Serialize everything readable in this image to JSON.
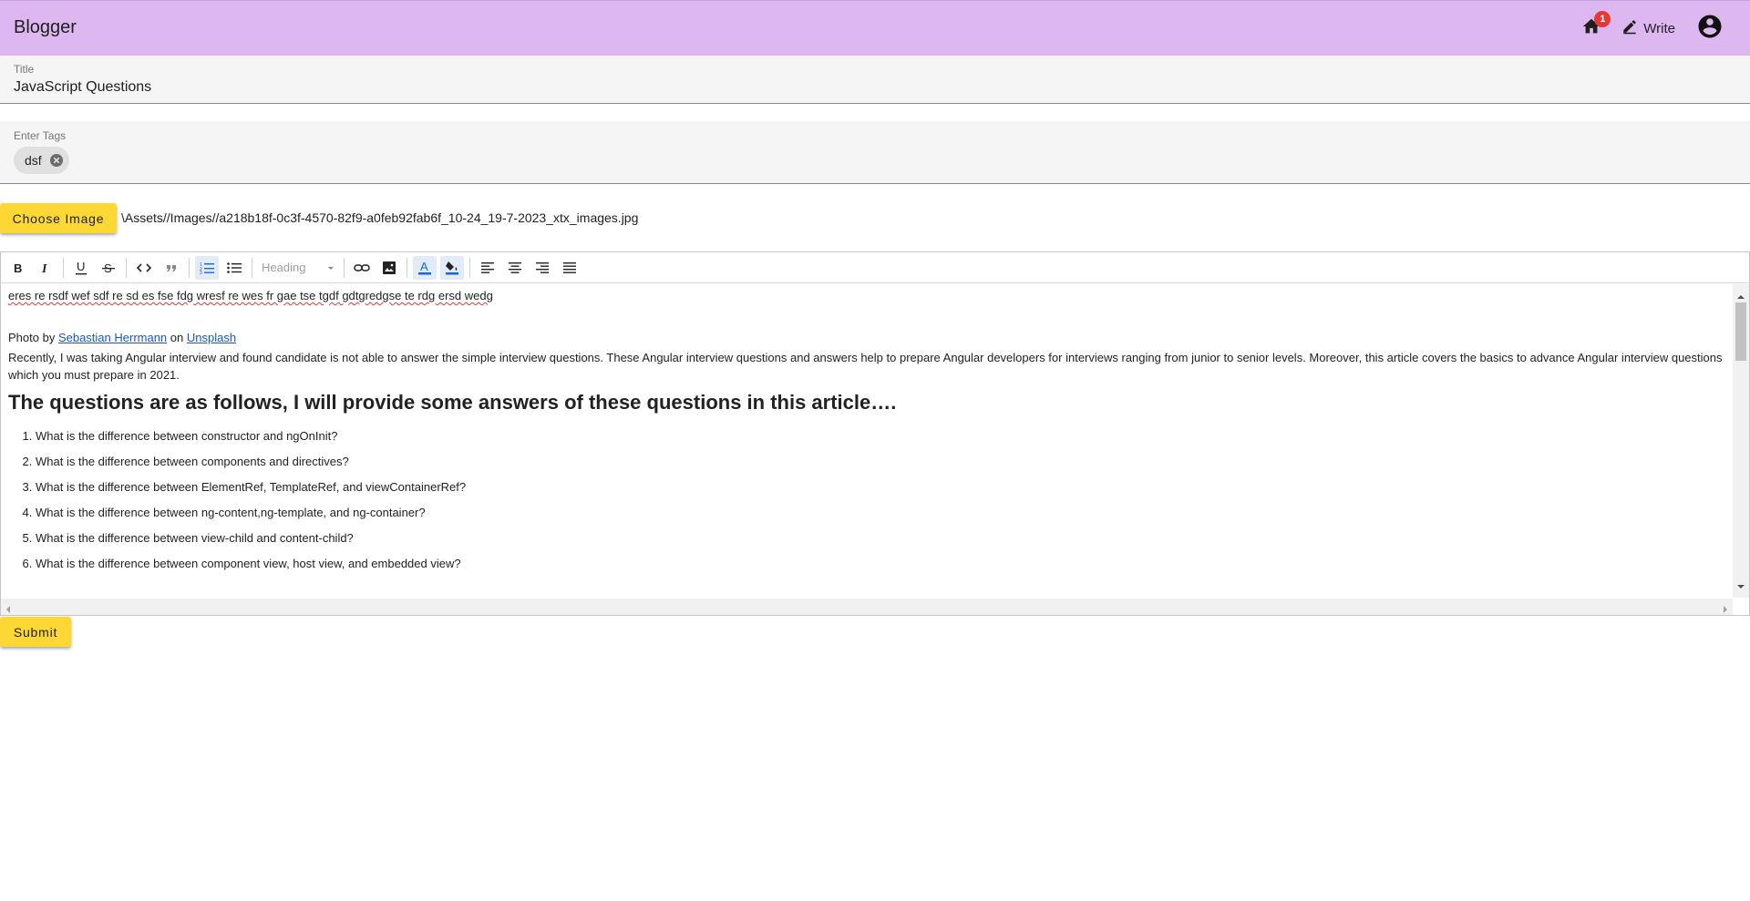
{
  "app": {
    "brand": "Blogger"
  },
  "header": {
    "notification_count": "1",
    "write_label": "Write"
  },
  "form": {
    "title_label": "Title",
    "title_value": "JavaScript Questions",
    "tags_label": "Enter Tags",
    "tags": [
      "dsf"
    ],
    "choose_image_label": "Choose Image",
    "image_path": "\\Assets//Images//a218b18f-0c3f-4570-82f9-a0feb92fab6f_10-24_19-7-2023_xtx_images.jpg",
    "submit_label": "Submit"
  },
  "toolbar": {
    "heading_placeholder": "Heading",
    "icons": [
      "bold-icon",
      "italic-icon",
      "underline-icon",
      "strikethrough-icon",
      "code-icon",
      "quote-icon",
      "ordered-list-icon",
      "bullet-list-icon",
      "link-icon",
      "image-icon",
      "text-color-icon",
      "highlight-icon",
      "align-left-icon",
      "align-center-icon",
      "align-right-icon",
      "align-justify-icon"
    ]
  },
  "editor": {
    "line1": "eres re rsdf wef sdf re sd es fse fdg wresf re wes fr gae tse tgdf gdtgredgse te rdg ersd wedg",
    "photo_prefix": "Photo by ",
    "photo_author": "Sebastian Herrmann",
    "photo_on": " on ",
    "photo_site": "Unsplash",
    "paragraph": "Recently, I was taking Angular interview and found candidate is not able to answer the simple interview questions. These Angular interview questions and answers help to prepare Angular developers for interviews ranging from junior to senior levels. Moreover, this article covers the basics to advance Angular interview questions which you must prepare in 2021.",
    "heading": "The questions are as follows, I will provide some answers of these questions in this article….",
    "questions": [
      "What is the difference between constructor and ngOnInit?",
      "What is the difference between components and directives?",
      "What is the difference between ElementRef, TemplateRef, and viewContainerRef?",
      "What is the difference between ng-content,ng-template, and ng-container?",
      "What is the difference between view-child and content-child?",
      "What is the difference between component view, host view, and embedded view?"
    ]
  },
  "colors": {
    "topbar": "#ddb7ef",
    "accent_button": "#fdd835",
    "badge": "#e53935",
    "link": "#1a55c9"
  }
}
